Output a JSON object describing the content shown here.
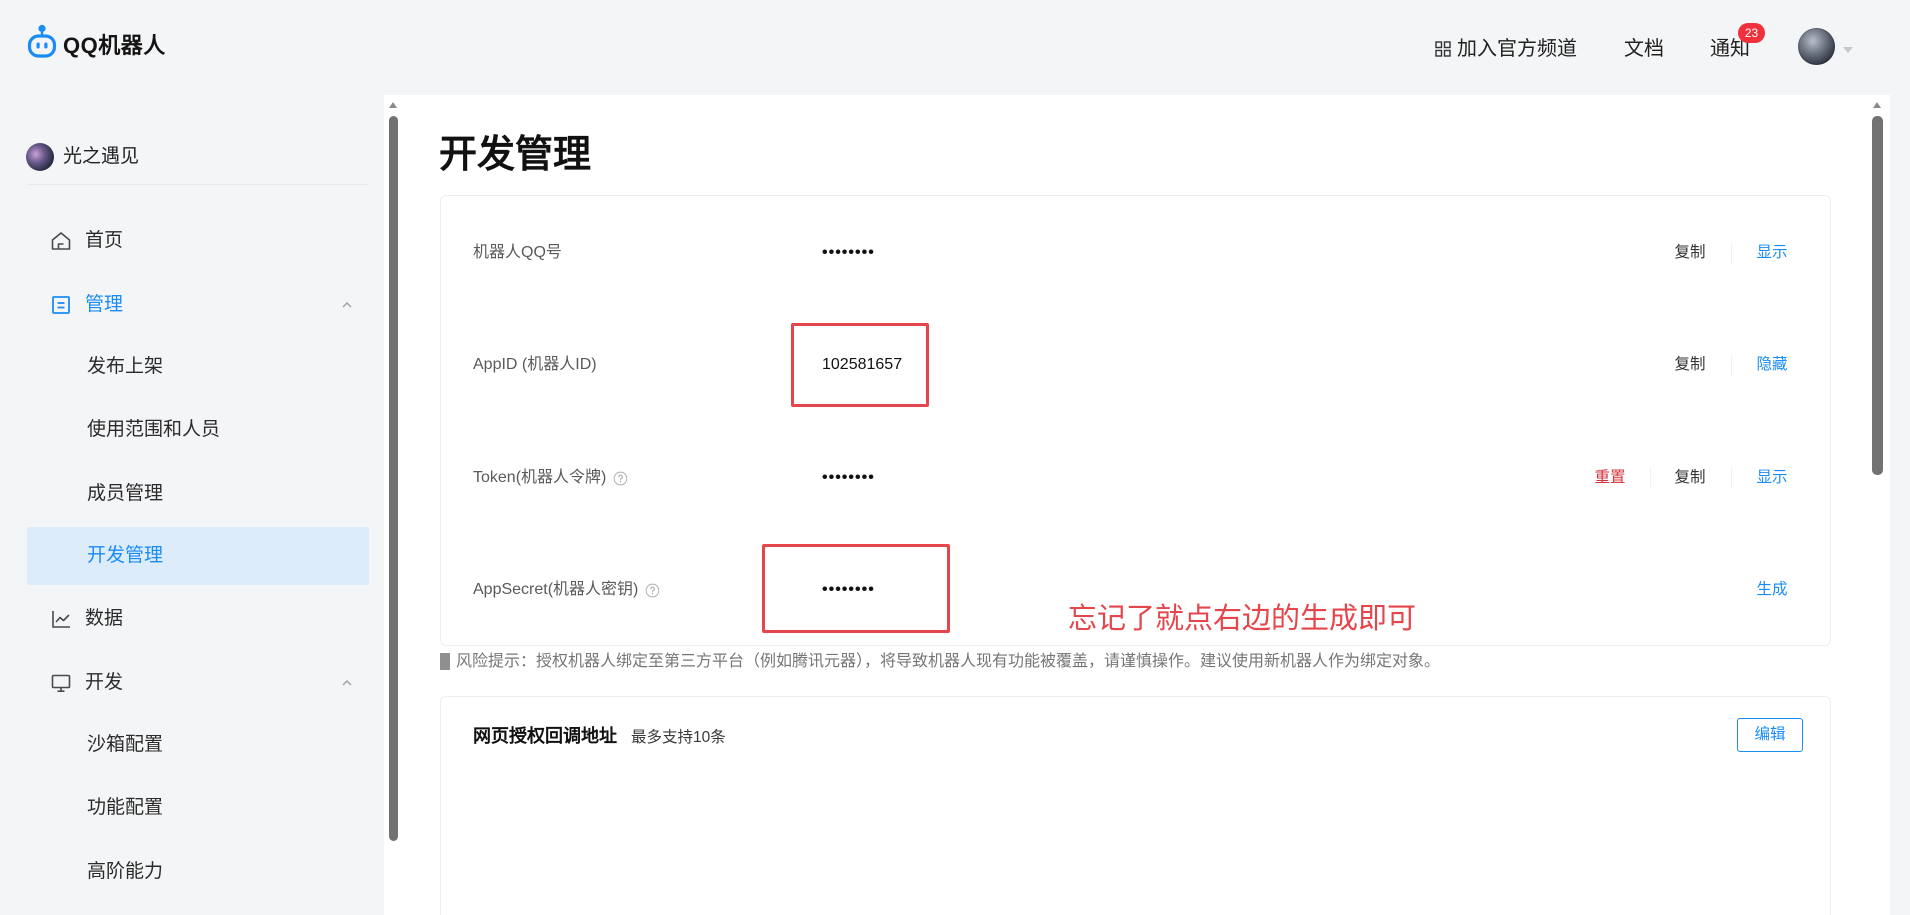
{
  "app": {
    "logo_text": "QQ机器人"
  },
  "header": {
    "join_channel_label": "加入官方频道",
    "docs_label": "文档",
    "notifications_label": "通知",
    "notification_count": "23"
  },
  "sidebar": {
    "user_name": "光之遇见",
    "items": [
      {
        "label": "首页",
        "icon": "home-icon",
        "level": 1
      },
      {
        "label": "管理",
        "icon": "manage-icon",
        "level": 1,
        "expanded": true,
        "group_active": true
      },
      {
        "label": "发布上架",
        "level": 2
      },
      {
        "label": "使用范围和人员",
        "level": 2
      },
      {
        "label": "成员管理",
        "level": 2
      },
      {
        "label": "开发管理",
        "level": 2,
        "selected": true
      },
      {
        "label": "数据",
        "icon": "chart-icon",
        "level": 1
      },
      {
        "label": "开发",
        "icon": "monitor-icon",
        "level": 1,
        "expanded": true
      },
      {
        "label": "沙箱配置",
        "level": 2
      },
      {
        "label": "功能配置",
        "level": 2
      },
      {
        "label": "高阶能力",
        "level": 2
      }
    ]
  },
  "main": {
    "title": "开发管理",
    "credentials": [
      {
        "label": "机器人QQ号",
        "value": "••••••••",
        "masked": true,
        "actions": {
          "copy": "复制",
          "toggle": "显示"
        }
      },
      {
        "label": "AppID (机器人ID)",
        "value": "102581657",
        "masked": false,
        "actions": {
          "copy": "复制",
          "toggle": "隐藏"
        }
      },
      {
        "label": "Token(机器人令牌)",
        "value": "••••••••",
        "masked": true,
        "has_help": true,
        "actions": {
          "reset": "重置",
          "copy": "复制",
          "toggle": "显示"
        }
      },
      {
        "label": "AppSecret(机器人密钥)",
        "value": "••••••••",
        "masked": true,
        "has_help": true,
        "actions": {
          "generate": "生成"
        }
      }
    ],
    "risk_notice": "风险提示：授权机器人绑定至第三方平台（例如腾讯元器），将导致机器人现有功能被覆盖，请谨慎操作。建议使用新机器人作为绑定对象。",
    "callback": {
      "title": "网页授权回调地址",
      "hint": "最多支持10条",
      "edit_label": "编辑"
    }
  },
  "annotation": {
    "text": "忘记了就点右边的生成即可"
  },
  "colors": {
    "accent": "#1a8cf5",
    "danger": "#d6343c",
    "annotation": "#e4464b",
    "selected_bg": "#dcecfb",
    "badge": "#f0313b"
  }
}
